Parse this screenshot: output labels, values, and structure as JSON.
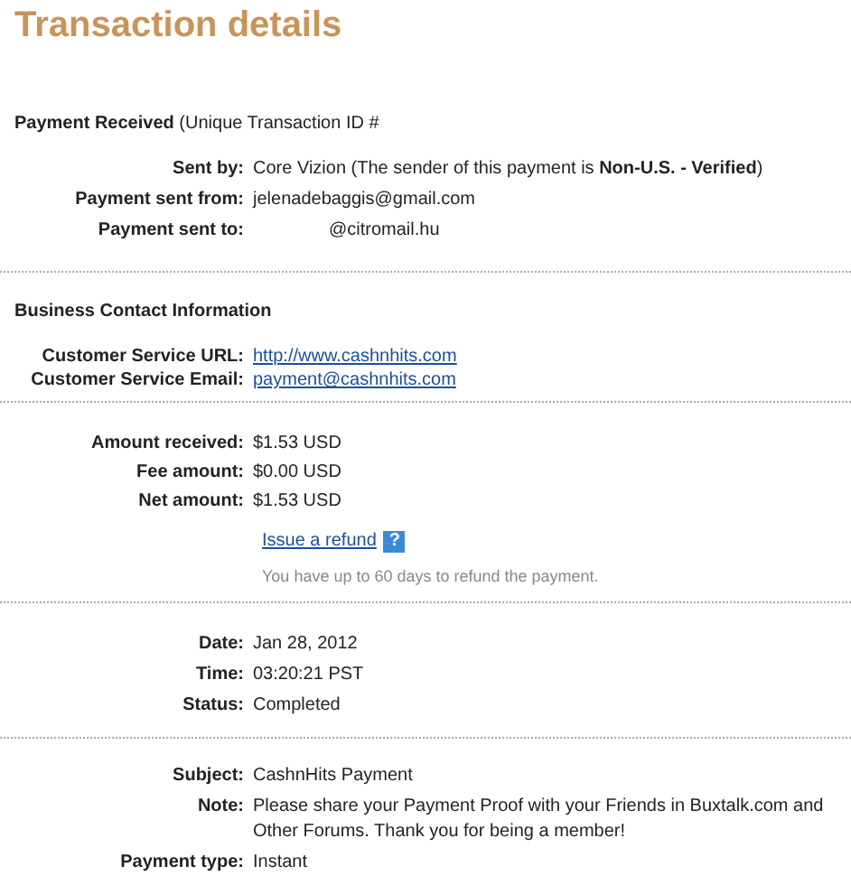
{
  "title": "Transaction details",
  "payment_header": "**Payment Received** (Unique Transaction ID #",
  "sender_rows": [
    {
      "label": "Sent by:",
      "value": "Core Vizion (The sender of this payment is **Non-U.S. - Verified**)",
      "kind": "text"
    },
    {
      "label": "Payment sent from:",
      "value": "jelenadebaggis@gmail.com",
      "kind": "text"
    },
    {
      "label": "Payment sent to:",
      "value": "@citromail.hu",
      "kind": "redacted"
    }
  ],
  "business_heading": "Business Contact Information",
  "business_rows": [
    {
      "label": "Customer Service URL:",
      "value": "http://www.cashnhits.com",
      "kind": "link"
    },
    {
      "label": "Customer Service Email:",
      "value": "payment@cashnhits.com",
      "kind": "link"
    }
  ],
  "amount_rows": [
    {
      "label": "Amount received:",
      "value": "$1.53 USD",
      "kind": "text"
    },
    {
      "label": "Fee amount:",
      "value": "$0.00 USD",
      "kind": "text"
    },
    {
      "label": "Net amount:",
      "value": "$1.53 USD",
      "kind": "text"
    }
  ],
  "refund": {
    "link": "Issue a refund",
    "help": "?",
    "hint": "You have up to 60 days to refund the payment."
  },
  "date_rows": [
    {
      "label": "Date:",
      "value": "Jan 28, 2012",
      "kind": "text"
    },
    {
      "label": "Time:",
      "value": "03:20:21 PST",
      "kind": "text"
    },
    {
      "label": "Status:",
      "value": "Completed",
      "kind": "text"
    }
  ],
  "note_rows": [
    {
      "label": "Subject:",
      "value": "CashnHits Payment",
      "kind": "text"
    },
    {
      "label": "Note:",
      "value": "Please share your Payment Proof with your Friends in Buxtalk.com and Other Forums. Thank you for being a member!",
      "kind": "text"
    },
    {
      "label": "Payment type:",
      "value": "Instant",
      "kind": "text"
    }
  ]
}
